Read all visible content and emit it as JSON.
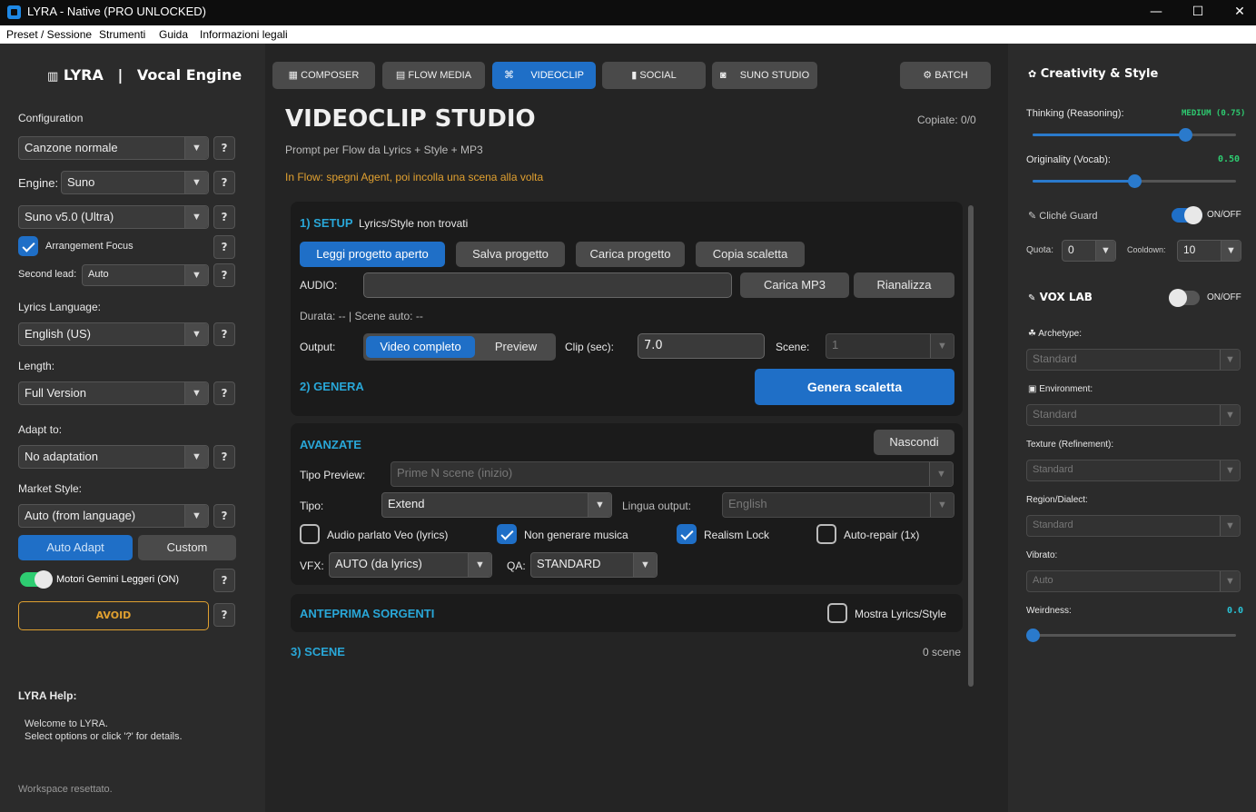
{
  "window": {
    "title": "LYRA - Native (PRO UNLOCKED)",
    "min": "—",
    "max": "☐",
    "close": "✕"
  },
  "menu": [
    "Preset / Sessione",
    "Strumenti",
    "Guida",
    "Informazioni legali"
  ],
  "left": {
    "brand": "LYRA",
    "brand_sep": "|",
    "subtitle": "Vocal Engine",
    "config_label": "Configuration",
    "song_type": "Canzone normale",
    "engine_label": "Engine:",
    "engine": "Suno",
    "model": "Suno v5.0 (Ultra)",
    "arrangement_focus": "Arrangement Focus",
    "second_lead_label": "Second lead:",
    "second_lead": "Auto",
    "lyrics_lang_label": "Lyrics Language:",
    "lyrics_lang": "English (US)",
    "length_label": "Length:",
    "length": "Full Version",
    "adapt_label": "Adapt to:",
    "adapt": "No adaptation",
    "market_label": "Market Style:",
    "market": "Auto (from language)",
    "auto_adapt": "Auto Adapt",
    "custom": "Custom",
    "gemini": "Motori Gemini Leggeri (ON)",
    "avoid": "AVOID",
    "help_title": "LYRA Help:",
    "help_line1": "Welcome to LYRA.",
    "help_line2": "Select options or click '?' for details.",
    "status": "Workspace resettato.",
    "q": "?"
  },
  "tabs": [
    {
      "icon": "▦",
      "label": "COMPOSER"
    },
    {
      "icon": "▤",
      "label": "FLOW MEDIA"
    },
    {
      "icon": "⌘",
      "label": "VIDEOCLIP"
    },
    {
      "icon": "▮",
      "label": "SOCIAL"
    },
    {
      "icon": "◙",
      "label": "SUNO STUDIO"
    },
    {
      "icon": "⚙",
      "label": "BATCH"
    }
  ],
  "center": {
    "title": "VIDEOCLIP STUDIO",
    "copies": "Copiate: 0/0",
    "subtitle": "Prompt per Flow da Lyrics + Style + MP3",
    "warning": "In Flow: spegni Agent, poi incolla una scena alla volta",
    "setup_title": "1) SETUP",
    "setup_status": "Lyrics/Style non trovati",
    "btn_read": "Leggi progetto aperto",
    "btn_save": "Salva progetto",
    "btn_load": "Carica progetto",
    "btn_copy": "Copia scaletta",
    "audio_label": "AUDIO:",
    "btn_mp3": "Carica MP3",
    "btn_reanalyze": "Rianalizza",
    "duration": "Durata: -- | Scene auto: --",
    "output_label": "Output:",
    "seg_full": "Video completo",
    "seg_preview": "Preview",
    "clip_label": "Clip (sec):",
    "clip_value": "7.0",
    "scene_label": "Scene:",
    "scene_value": "1",
    "genera_title": "2) GENERA",
    "btn_genera": "Genera scaletta",
    "adv_title": "AVANZATE",
    "btn_hide": "Nascondi",
    "tipo_preview_label": "Tipo Preview:",
    "tipo_preview": "Prime N scene (inizio)",
    "tipo_label": "Tipo:",
    "tipo": "Extend",
    "lingua_label": "Lingua output:",
    "lingua": "English",
    "chk_audio": "Audio parlato Veo (lyrics)",
    "chk_nomusic": "Non generare musica",
    "chk_realism": "Realism Lock",
    "chk_autorepair": "Auto-repair (1x)",
    "vfx_label": "VFX:",
    "vfx": "AUTO (da lyrics)",
    "qa_label": "QA:",
    "qa": "STANDARD",
    "preview_src_title": "ANTEPRIMA SORGENTI",
    "show_lyrics": "Mostra Lyrics/Style",
    "scene_title": "3) SCENE",
    "scene_count": "0 scene"
  },
  "right": {
    "title": "Creativity & Style",
    "thinking_label": "Thinking (Reasoning):",
    "thinking_value": "MEDIUM (0.75)",
    "thinking_level": 0.75,
    "originality_label": "Originality (Vocab):",
    "originality_value": "0.50",
    "originality_level": 0.5,
    "cliche_label": "Cliché Guard",
    "onoff": "ON/OFF",
    "quota_label": "Quota:",
    "quota": "0",
    "cooldown_label": "Cooldown:",
    "cooldown": "10",
    "vox_title": "VOX LAB",
    "archetype_label": "Archetype:",
    "archetype": "Standard",
    "environment_label": "Environment:",
    "environment": "Standard",
    "texture_label": "Texture (Refinement):",
    "texture": "Standard",
    "region_label": "Region/Dialect:",
    "region": "Standard",
    "vibrato_label": "Vibrato:",
    "vibrato": "Auto",
    "weirdness_label": "Weirdness:",
    "weirdness_value": "0.0",
    "weirdness_level": 0.0
  },
  "colors": {
    "accent": "#1f6fc7",
    "cyan": "#29a7d8",
    "green": "#2ecc71",
    "orange": "#e0a030"
  }
}
